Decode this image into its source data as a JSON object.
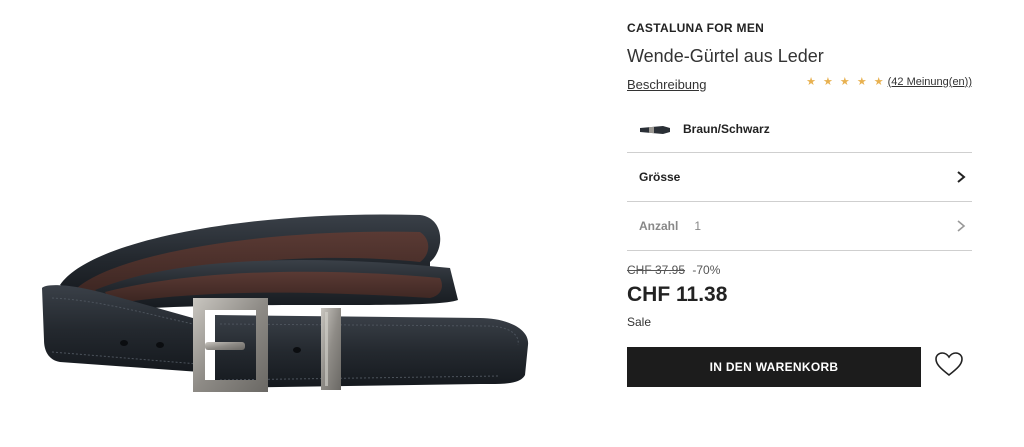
{
  "product": {
    "brand": "CASTALUNA FOR MEN",
    "title": "Wende-Gürtel aus Leder",
    "image_alt": "belt-photo"
  },
  "description_link": "Beschreibung",
  "rating": {
    "stars": "★ ★ ★ ★ ★",
    "reviews_label": "(42 Meinung(en))",
    "star_color": "#e8b150"
  },
  "color": {
    "label": "Braun/Schwarz"
  },
  "size": {
    "label": "Grösse"
  },
  "quantity": {
    "label": "Anzahl",
    "value": "1"
  },
  "pricing": {
    "old_price": "CHF 37.95",
    "discount": "-70%",
    "price": "CHF 11.38",
    "sale_label": "Sale"
  },
  "actions": {
    "add_to_cart": "IN DEN WARENKORB"
  },
  "colors": {
    "button_bg": "#1c1c1c",
    "divider": "#cfcfcf"
  }
}
